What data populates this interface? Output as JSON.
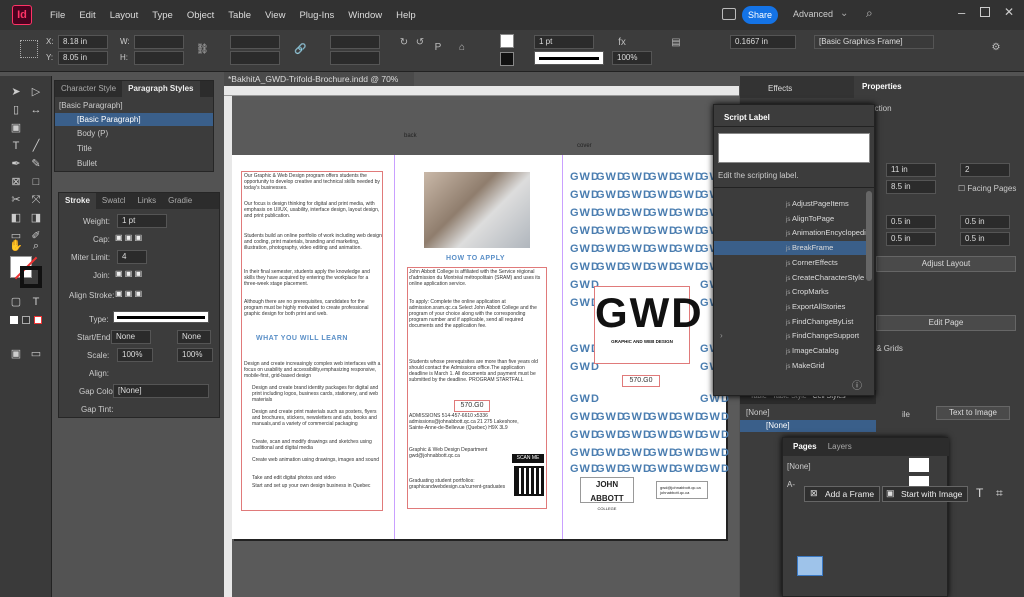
{
  "app": {
    "logo": "Id",
    "share": "Share",
    "workspace": "Advanced"
  },
  "menu": [
    "File",
    "Edit",
    "Layout",
    "Type",
    "Object",
    "Table",
    "View",
    "Plug-Ins",
    "Window",
    "Help"
  ],
  "control": {
    "x": "8.18 in",
    "y": "8.05 in",
    "w_label": "W:",
    "h_label": "H:",
    "x_label": "X:",
    "y_label": "Y:",
    "stroke": "1 pt",
    "percent": "100%",
    "offset": "0.1667 in",
    "style": "[Basic Graphics Frame]"
  },
  "document": {
    "tab": "*BakhitA_GWD-Trifold-Brochure.indd @ 70%"
  },
  "paragraph_panel": {
    "tabs": [
      "Character Style",
      "Paragraph Styles"
    ],
    "current": "[Basic Paragraph]",
    "items": [
      "[Basic Paragraph]",
      "Body (P)",
      "Title",
      "Bullet"
    ]
  },
  "stroke_panel": {
    "tabs": [
      "Stroke",
      "Swatcl",
      "Links",
      "Gradie"
    ],
    "weight_label": "Weight:",
    "weight": "1 pt",
    "cap_label": "Cap:",
    "miter_label": "Miter Limit:",
    "miter": "4",
    "join_label": "Join:",
    "align_label": "Align Stroke:",
    "type_label": "Type:",
    "startend_label": "Start/End:",
    "start": "None",
    "end": "None",
    "scale_label": "Scale:",
    "scale1": "100%",
    "scale2": "100%",
    "align2_label": "Align:",
    "gapcolor_label": "Gap Color:",
    "gapcolor": "[None]",
    "gaptint_label": "Gap Tint:"
  },
  "brochure": {
    "labels": [
      "back",
      "cover"
    ],
    "col1": [
      "Our Graphic & Web Design program offers students the opportunity to develop creative and technical skills needed by today's businesses.",
      "Our focus is design thinking for digital and print media, with emphasis on UI/UX, usability, interface design, layout design, and print publication.",
      "Students build an online portfolio of work including web design and coding, print materials, branding and marketing, illustration, photography, video editing and animation.",
      "In their final semester, students apply the knowledge and skills they have acquired by entering the workplace for a three-week stage placement.",
      "Although there are no prerequisites, candidates for the program must be highly motivated to create professional graphic design for both print and web."
    ],
    "learn_heading": "WHAT YOU WILL LEARN",
    "learn_intro": "Design and create increasingly complex web interfaces with a focus on usability and accessibility,emphasizing responsive, mobile-first, grid-based design",
    "learn_items": [
      "Design and create brand identity packages for digital and print including logos, business cards, stationery, and web materials",
      "Design and create print materials such as posters, flyers and brochures, stickers, newsletters and ads, books and manuals,and a variety of commercial packaging",
      "Create, scan and modify drawings and sketches using traditional and digital media",
      "Create web animation using drawings, images and sound",
      "Take and edit digital photos and video",
      "Start and set up your own design business in Quebec"
    ],
    "apply_heading": "HOW TO APPLY",
    "apply_p1": "John Abbott College is affiliated with the Service régional d'admission du Montréal métropolitain (SRAM) and uses its online application service.",
    "apply_p2": "To apply: Complete the online application at admission.sram.qc.ca Select John Abbott College and the program of your choice along with the corresponding program number and if applicable, send all required documents and the application fee.",
    "apply_p3": "Students whose prerequisites are more than five years old should contact the Admissions office.The application deadline is March 1. All documents and payment must be submitted by the deadline. PROGRAM STARTFALL",
    "program_code": "570.G0",
    "admissions": "ADMISSIONS 514-457-6610 x5336 admissions@johnabbott.qc.ca 21 275 Lakeshore, Sainte-Anne-de-Bellevue (Quebec) H9X 3L9",
    "dept": "Graphic & Web Design Department gwd@johnabbott.qc.ca",
    "scan": "SCAN ME",
    "portfolios": "Graduating student portfolios: graphicandwebdesign.ca/current-graduates",
    "gwd_tile": "GWD",
    "gwd_big": "GWD",
    "gwd_sub": "GRAPHIC AND WEB DESIGN",
    "cover_code": "570.G0",
    "ja_logo": "JOHN ABBOTT",
    "ja_sub": "COLLEGE",
    "cover_email": "gwd@johnabbott.qc.ca johnabbott.qc.ca"
  },
  "right_panels": {
    "effects": "Effects",
    "properties": "Properties",
    "selection": "election",
    "p11": "11 in",
    "p2": "2",
    "p85": "8.5 in",
    "facing": "Facing Pages",
    "m1": "0.5 in",
    "m2": "0.5 in",
    "m3": "0.5 in",
    "m4": "0.5 in",
    "adjust": "Adjust Layout",
    "editpage": "Edit Page",
    "grids": "s & Grids",
    "texttoimage": "Text to Image",
    "ile": "ile"
  },
  "script_label": {
    "title": "Script Label",
    "hint": "Edit the scripting label.",
    "items": [
      "AdjustPageItems",
      "AlignToPage",
      "AnimationEncyclopedia",
      "BreakFrame",
      "CornerEffects",
      "CreateCharacterStyle",
      "CropMarks",
      "ExportAllStories",
      "FindChangeByList",
      "FindChangeSupport",
      "ImageCatalog",
      "MakeGrid"
    ],
    "selected": "BreakFrame"
  },
  "pages_panel": {
    "tabs": [
      "Pages",
      "Layers"
    ],
    "none": "[None]",
    "amaster": "A-",
    "add_frame": "Add a Frame",
    "start_image": "Start with Image"
  },
  "cell_styles": {
    "tabs": [
      "Table",
      "Table Style",
      "Cell Styles"
    ],
    "none1": "[None]",
    "none2": "[None]"
  }
}
